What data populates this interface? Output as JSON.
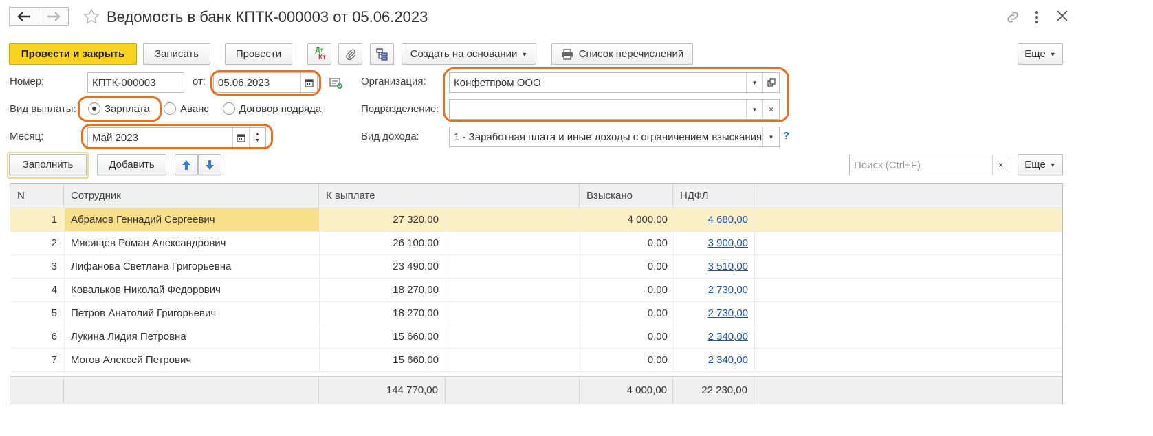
{
  "window": {
    "title": "Ведомость в банк КПТК-000003 от 05.06.2023"
  },
  "toolbar": {
    "post_close": "Провести и закрыть",
    "write": "Записать",
    "post": "Провести",
    "dt_kt_top": "Дт",
    "dt_kt_bottom": "Кт",
    "create_based": "Создать на основании",
    "transfer_list": "Список перечислений",
    "more": "Еще"
  },
  "form": {
    "number_label": "Номер:",
    "number_value": "КПТК-000003",
    "date_label": "от:",
    "date_value": "05.06.2023",
    "org_label": "Организация:",
    "org_value": "Конфетпром ООО",
    "pay_type_label": "Вид выплаты:",
    "pay_types": [
      "Зарплата",
      "Аванс",
      "Договор подряда"
    ],
    "pay_type_selected": "Зарплата",
    "dept_label": "Подразделение:",
    "dept_value": "",
    "month_label": "Месяц:",
    "month_value": "Май 2023",
    "income_label": "Вид дохода:",
    "income_value": "1 - Заработная плата и иные доходы с ограничением взыскания",
    "help": "?"
  },
  "table_toolbar": {
    "fill": "Заполнить",
    "add": "Добавить",
    "search_placeholder": "Поиск (Ctrl+F)",
    "more": "Еще"
  },
  "table": {
    "columns": [
      "N",
      "Сотрудник",
      "К выплате",
      "Взыскано",
      "НДФЛ"
    ],
    "rows": [
      {
        "n": "1",
        "employee": "Абрамов Геннадий Сергеевич",
        "pay": "27 320,00",
        "withheld": "4 000,00",
        "ndfl": "4 680,00"
      },
      {
        "n": "2",
        "employee": "Мясищев Роман Александрович",
        "pay": "26 100,00",
        "withheld": "0,00",
        "ndfl": "3 900,00"
      },
      {
        "n": "3",
        "employee": "Лифанова Светлана Григорьевна",
        "pay": "23 490,00",
        "withheld": "0,00",
        "ndfl": "3 510,00"
      },
      {
        "n": "4",
        "employee": "Ковальков Николай Федорович",
        "pay": "18 270,00",
        "withheld": "0,00",
        "ndfl": "2 730,00"
      },
      {
        "n": "5",
        "employee": "Петров Анатолий Григорьевич",
        "pay": "18 270,00",
        "withheld": "0,00",
        "ndfl": "2 730,00"
      },
      {
        "n": "6",
        "employee": "Лукина Лидия Петровна",
        "pay": "15 660,00",
        "withheld": "0,00",
        "ndfl": "2 340,00"
      },
      {
        "n": "7",
        "employee": "Могов Алексей Петрович",
        "pay": "15 660,00",
        "withheld": "0,00",
        "ndfl": "2 340,00"
      }
    ],
    "totals": {
      "pay": "144 770,00",
      "withheld": "4 000,00",
      "ndfl": "22 230,00"
    }
  },
  "colors": {
    "accent_yellow": "#f7d31f",
    "highlight_orange": "#e8701c",
    "selected_row": "#fbefc4",
    "link_blue": "#1f4fb4"
  },
  "icons": [
    "arrow-left-icon",
    "arrow-right-icon",
    "star-icon",
    "link-icon",
    "more-vertical-icon",
    "close-icon",
    "dt-kt-icon",
    "paperclip-icon",
    "structure-icon",
    "printer-icon",
    "calendar-icon",
    "document-check-icon",
    "open-icon",
    "clear-icon",
    "dropdown-icon",
    "arrow-up-icon",
    "arrow-down-icon"
  ]
}
